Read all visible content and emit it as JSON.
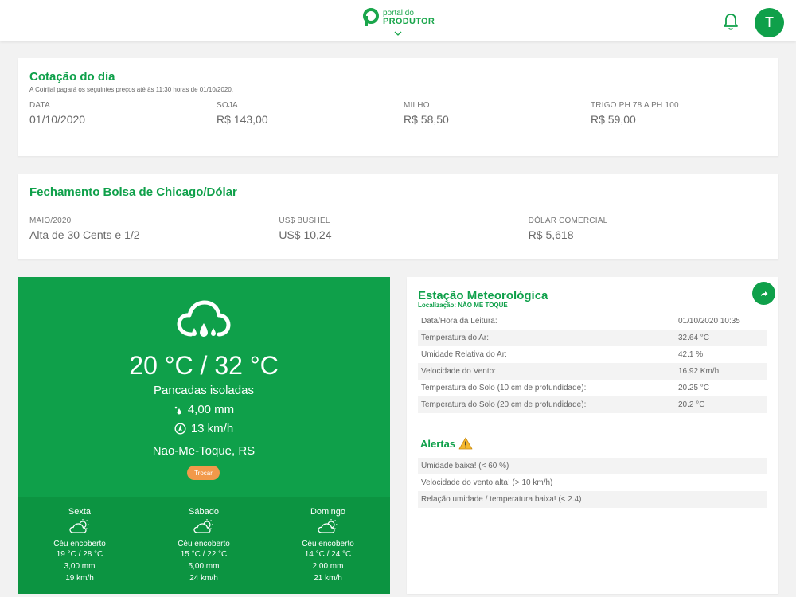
{
  "header": {
    "logo_small": "portal do",
    "logo_big": "PRODUTOR",
    "avatar_letter": "T"
  },
  "cotacao": {
    "title": "Cotação do dia",
    "subtitle": "A Cotrijal pagará os seguintes preços até às 11:30 horas de 01/10/2020.",
    "items": [
      {
        "label": "DATA",
        "value": "01/10/2020"
      },
      {
        "label": "SOJA",
        "value": "R$ 143,00"
      },
      {
        "label": "MILHO",
        "value": "R$ 58,50"
      },
      {
        "label": "TRIGO PH 78 A PH 100",
        "value": "R$ 59,00"
      }
    ]
  },
  "bolsa": {
    "title": "Fechamento Bolsa de Chicago/Dólar",
    "items": [
      {
        "label": "MAIO/2020",
        "value": "Alta de 30 Cents e 1/2"
      },
      {
        "label": "US$ BUSHEL",
        "value": "US$ 10,24"
      },
      {
        "label": "DÓLAR COMERCIAL",
        "value": "R$ 5,618"
      }
    ]
  },
  "weather": {
    "temp": "20 °C / 32 °C",
    "condition": "Pancadas isoladas",
    "rain": "4,00 mm",
    "wind": "13 km/h",
    "location": "Nao-Me-Toque, RS",
    "change_button": "Trocar",
    "forecast": [
      {
        "day": "Sexta",
        "condition": "Céu encoberto",
        "temp": "19 °C / 28 °C",
        "rain": "3,00 mm",
        "wind": "19 km/h"
      },
      {
        "day": "Sábado",
        "condition": "Céu encoberto",
        "temp": "15 °C / 22 °C",
        "rain": "5,00 mm",
        "wind": "24 km/h"
      },
      {
        "day": "Domingo",
        "condition": "Céu encoberto",
        "temp": "14 °C / 24 °C",
        "rain": "2,00 mm",
        "wind": "21 km/h"
      }
    ]
  },
  "estacao": {
    "title": "Estação Meteorológica",
    "location": "Localização: NÃO ME TOQUE",
    "rows": [
      {
        "k": "Data/Hora da Leitura:",
        "v": "01/10/2020 10:35"
      },
      {
        "k": "Temperatura do Ar:",
        "v": "32.64 °C"
      },
      {
        "k": "Umidade Relativa do Ar:",
        "v": "42.1 %"
      },
      {
        "k": "Velocidade do Vento:",
        "v": "16.92 Km/h"
      },
      {
        "k": "Temperatura do Solo (10 cm de profundidade):",
        "v": "20.25 °C"
      },
      {
        "k": "Temperatura do Solo (20 cm de profundidade):",
        "v": "20.2 °C"
      }
    ],
    "alerts_title": "Alertas",
    "alerts": [
      "Umidade baixa! (< 60 %)",
      "Velocidade do vento alta! (> 10 km/h)",
      "Relação umidade / temperatura baixa! (< 2.4)"
    ]
  }
}
